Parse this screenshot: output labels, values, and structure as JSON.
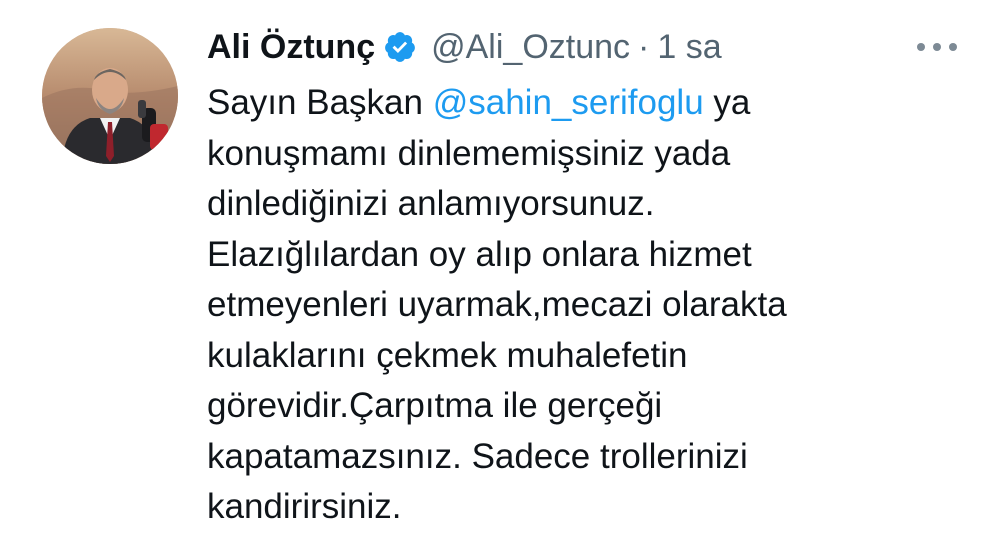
{
  "tweet": {
    "author": {
      "name": "Ali Öztunç",
      "handle": "@Ali_Oztunc",
      "verified": true
    },
    "separator": "·",
    "time": "1 sa",
    "more_icon": "more-horizontal-icon",
    "lines": [
      {
        "before": "Sayın Başkan ",
        "mention": "@sahin_serifoglu",
        "after": " ya"
      },
      {
        "text": "konuşmamı dinlememişsiniz yada"
      },
      {
        "text": "dinlediğinizi anlamıyorsunuz."
      },
      {
        "text": "Elazığlılardan oy alıp onlara hizmet"
      },
      {
        "text": "etmeyenleri uyarmak,mecazi olarakta"
      },
      {
        "text": "kulaklarını çekmek muhalefetin"
      },
      {
        "text": "görevidir.Çarpıtma ile gerçeği"
      },
      {
        "text": "kapatamazsınız. Sadece trollerinizi"
      },
      {
        "text": "kandirirsiniz."
      }
    ]
  },
  "colors": {
    "text": "#0f1419",
    "secondary": "#536471",
    "link": "#1d9bf0",
    "verified": "#1d9bf0"
  }
}
